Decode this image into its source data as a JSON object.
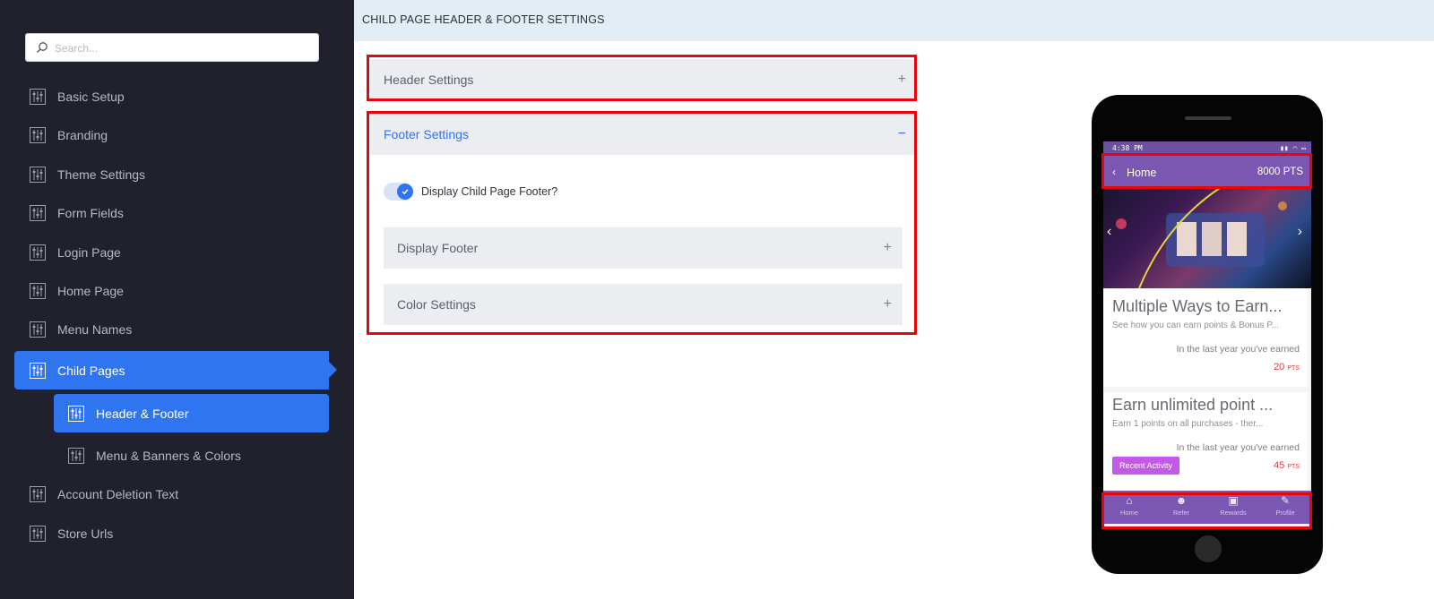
{
  "sidebar": {
    "search_placeholder": "Search...",
    "items": [
      {
        "label": "Basic Setup"
      },
      {
        "label": "Branding"
      },
      {
        "label": "Theme Settings"
      },
      {
        "label": "Form Fields"
      },
      {
        "label": "Login Page"
      },
      {
        "label": "Home Page"
      },
      {
        "label": "Menu Names"
      },
      {
        "label": "Child Pages"
      },
      {
        "label": "Header & Footer"
      },
      {
        "label": "Menu & Banners & Colors"
      },
      {
        "label": "Account Deletion Text"
      },
      {
        "label": "Store Urls"
      }
    ]
  },
  "page": {
    "title": "CHILD PAGE HEADER & FOOTER SETTINGS"
  },
  "panels": {
    "header_settings": {
      "label": "Header Settings",
      "toggle": "+"
    },
    "footer_settings": {
      "label": "Footer Settings",
      "toggle": "−"
    },
    "display_child_footer_label": "Display Child Page Footer?",
    "display_child_footer_checked": true,
    "display_footer": {
      "label": "Display Footer",
      "toggle": "+"
    },
    "color_settings": {
      "label": "Color Settings",
      "toggle": "+"
    }
  },
  "phone": {
    "status_time": "4:38 PM",
    "header": {
      "title": "Home",
      "points": "8000 PTS"
    },
    "cards": [
      {
        "title": "Multiple Ways to Earn...",
        "desc": "See how you can earn points & Bonus P...",
        "last_year": "In the last year you've earned",
        "points": "20",
        "unit": "PTS"
      },
      {
        "title": "Earn unlimited point ...",
        "desc": "Earn 1 points on all purchases - ther...",
        "last_year": "In the last year you've earned",
        "points": "45",
        "unit": "PTS",
        "button": "Recent Activity"
      }
    ],
    "nav": [
      "Home",
      "Refer",
      "Rewards",
      "Profile"
    ]
  },
  "colors": {
    "sidebar_bg": "#21212e",
    "accent": "#2f74f0",
    "highlight_box": "#e5060a",
    "phone_primary": "#7b56b2"
  }
}
